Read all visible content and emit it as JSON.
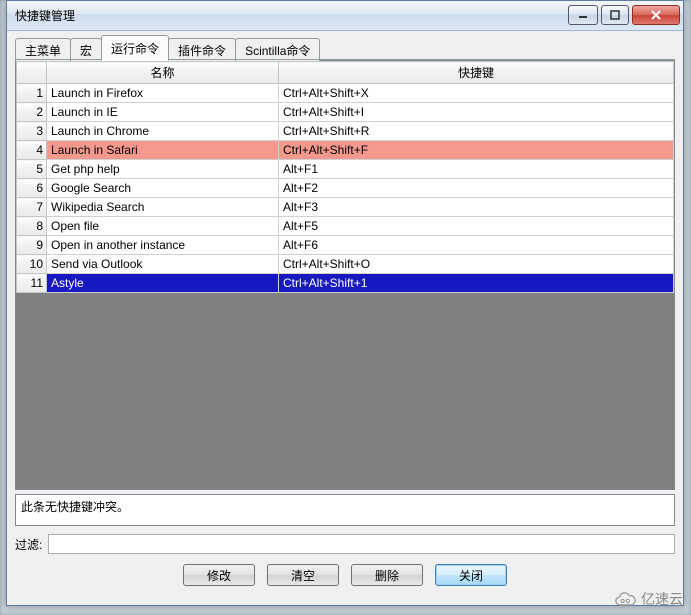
{
  "window": {
    "title": "快捷键管理"
  },
  "tabs": [
    {
      "label": "主菜单",
      "active": false
    },
    {
      "label": "宏",
      "active": false
    },
    {
      "label": "运行命令",
      "active": true
    },
    {
      "label": "插件命令",
      "active": false
    },
    {
      "label": "Scintilla命令",
      "active": false
    }
  ],
  "columns": {
    "index": "",
    "name": "名称",
    "shortcut": "快捷键"
  },
  "rows": [
    {
      "n": "1",
      "name": "Launch in Firefox",
      "shortcut": "Ctrl+Alt+Shift+X",
      "state": ""
    },
    {
      "n": "2",
      "name": "Launch in IE",
      "shortcut": "Ctrl+Alt+Shift+I",
      "state": ""
    },
    {
      "n": "3",
      "name": "Launch in Chrome",
      "shortcut": "Ctrl+Alt+Shift+R",
      "state": ""
    },
    {
      "n": "4",
      "name": "Launch in Safari",
      "shortcut": "Ctrl+Alt+Shift+F",
      "state": "conflict"
    },
    {
      "n": "5",
      "name": "Get php help",
      "shortcut": "Alt+F1",
      "state": ""
    },
    {
      "n": "6",
      "name": "Google Search",
      "shortcut": "Alt+F2",
      "state": ""
    },
    {
      "n": "7",
      "name": "Wikipedia Search",
      "shortcut": "Alt+F3",
      "state": ""
    },
    {
      "n": "8",
      "name": "Open file",
      "shortcut": "Alt+F5",
      "state": ""
    },
    {
      "n": "9",
      "name": "Open in another instance",
      "shortcut": "Alt+F6",
      "state": ""
    },
    {
      "n": "10",
      "name": "Send via Outlook",
      "shortcut": "Ctrl+Alt+Shift+O",
      "state": ""
    },
    {
      "n": "11",
      "name": "Astyle",
      "shortcut": "Ctrl+Alt+Shift+1",
      "state": "selected"
    }
  ],
  "conflict_msg": "此条无快捷键冲突。",
  "filter": {
    "label": "过滤:",
    "value": ""
  },
  "buttons": {
    "modify": "修改",
    "clear": "清空",
    "delete": "删除",
    "close": "关闭"
  },
  "watermark": "亿速云"
}
